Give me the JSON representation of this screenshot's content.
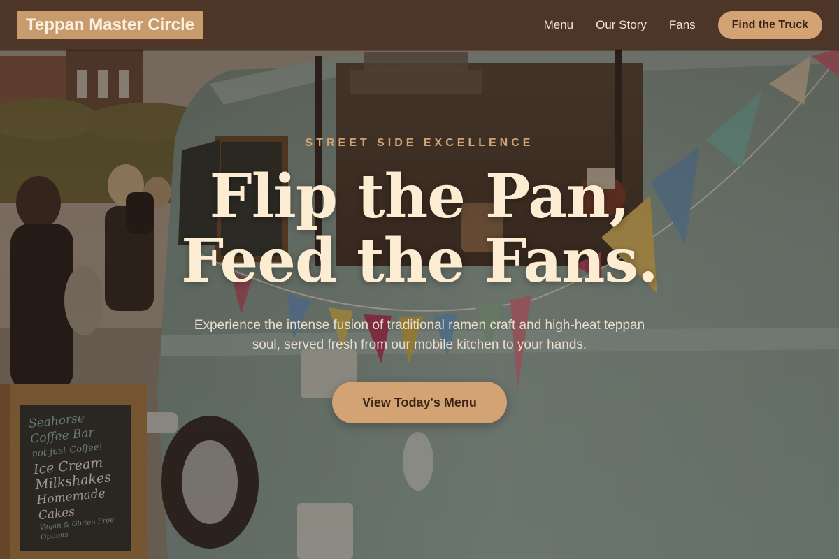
{
  "header": {
    "brand": "Teppan Master Circle",
    "nav": {
      "menu": "Menu",
      "our_story": "Our Story",
      "fans": "Fans"
    },
    "cta_label": "Find the Truck"
  },
  "hero": {
    "eyebrow": "STREET SIDE EXCELLENCE",
    "headline_line1": "Flip the Pan,",
    "headline_line2": "Feed the Fans.",
    "subtitle": "Experience the intense fusion of traditional ramen craft and high-heat teppan soul, served fresh from our mobile kitchen to your hands.",
    "cta_label": "View Today's Menu",
    "background": "food-truck-photo"
  },
  "sign": {
    "lines": [
      "Seahorse",
      "Coffee Bar",
      "not just Coffee!",
      "Ice Cream",
      "Milkshakes",
      "Homemade Cakes",
      "Vegan & Gluten Free Options"
    ]
  },
  "colors": {
    "header_bg": "#4a3325",
    "accent": "#d4a373",
    "brand_bg": "#c89b6d",
    "headline": "#fbecd2",
    "body_text": "#e8dccb"
  }
}
